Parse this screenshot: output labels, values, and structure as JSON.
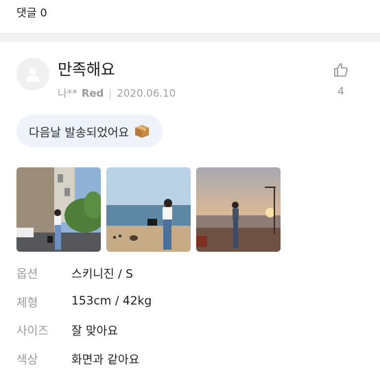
{
  "comments": {
    "label": "댓글 0"
  },
  "review": {
    "title": "만족해요",
    "author": "나**",
    "option_color": "Red",
    "separator": "|",
    "date": "2020.06.10",
    "likes": "4",
    "summary": "다음날 발송되었어요",
    "summary_icon": "package-icon",
    "photos": [
      {
        "icon": "photo-1"
      },
      {
        "icon": "photo-2"
      },
      {
        "icon": "photo-3"
      }
    ],
    "specs": [
      {
        "label": "옵션",
        "value": "스키니진 / S"
      },
      {
        "label": "체형",
        "value": "153cm / 42kg"
      },
      {
        "label": "사이즈",
        "value": "잘 맞아요"
      },
      {
        "label": "색상",
        "value": "화면과 같아요"
      }
    ]
  },
  "colors": {
    "summary_bg": "#eef3fb",
    "muted": "#9a9aa0",
    "divider": "#f2f2f3"
  }
}
